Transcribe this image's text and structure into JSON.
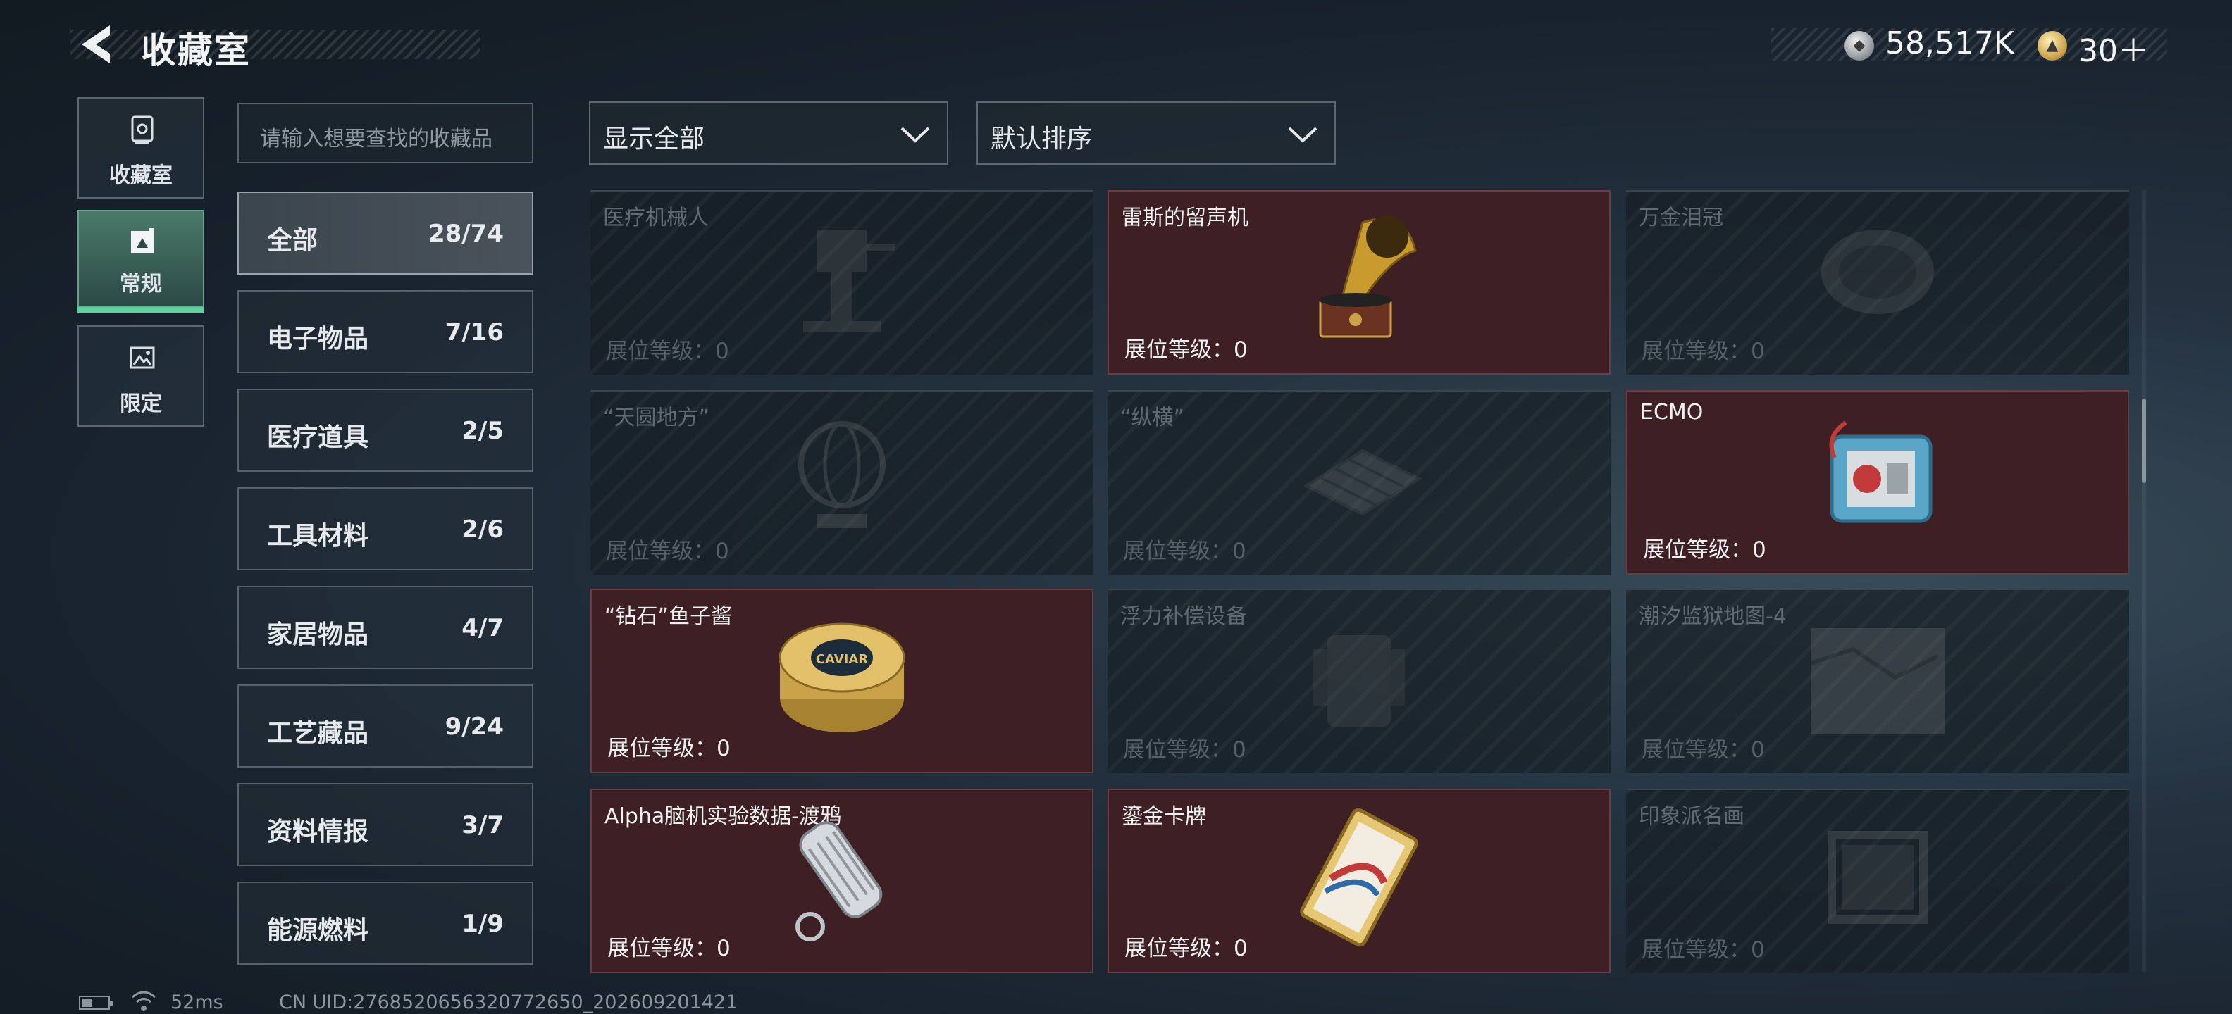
{
  "header": {
    "title": "收藏室"
  },
  "currency": {
    "silver_amount": "58,517K",
    "gold_amount": "30＋"
  },
  "nav_tabs": [
    {
      "label": "收藏室",
      "icon": "vault-icon",
      "active": false
    },
    {
      "label": "常规",
      "icon": "frame-icon",
      "active": true
    },
    {
      "label": "限定",
      "icon": "picture-icon",
      "active": false
    }
  ],
  "search": {
    "placeholder": "请输入想要查找的收藏品"
  },
  "filters": {
    "show_label": "显示全部",
    "sort_label": "默认排序"
  },
  "categories": [
    {
      "name": "全部",
      "count": "28/74",
      "active": true
    },
    {
      "name": "电子物品",
      "count": "7/16"
    },
    {
      "name": "医疗道具",
      "count": "2/5"
    },
    {
      "name": "工具材料",
      "count": "2/6"
    },
    {
      "name": "家居物品",
      "count": "4/7"
    },
    {
      "name": "工艺藏品",
      "count": "9/24"
    },
    {
      "name": "资料情报",
      "count": "3/7"
    },
    {
      "name": "能源燃料",
      "count": "1/9"
    }
  ],
  "items": [
    {
      "name": "医疗机械人",
      "level": "展位等级：0",
      "owned": false,
      "icon": "robot-icon"
    },
    {
      "name": "雷斯的留声机",
      "level": "展位等级：0",
      "owned": true,
      "icon": "gramophone-icon"
    },
    {
      "name": "万金泪冠",
      "level": "展位等级：0",
      "owned": false,
      "icon": "crown-icon"
    },
    {
      "name": "“天圆地方”",
      "level": "展位等级：0",
      "owned": false,
      "icon": "globe-icon"
    },
    {
      "name": "“纵横”",
      "level": "展位等级：0",
      "owned": false,
      "icon": "chessboard-icon"
    },
    {
      "name": "ECMO",
      "level": "展位等级：0",
      "owned": true,
      "icon": "ecmo-machine-icon"
    },
    {
      "name": "“钻石”鱼子酱",
      "level": "展位等级：0",
      "owned": true,
      "icon": "caviar-tin-icon",
      "tin_text": "CAVIAR"
    },
    {
      "name": "浮力补偿设备",
      "level": "展位等级：0",
      "owned": false,
      "icon": "bcd-icon"
    },
    {
      "name": "潮汐监狱地图-4",
      "level": "展位等级：0",
      "owned": false,
      "icon": "map-icon"
    },
    {
      "name": "Alpha脑机实验数据-渡鸦",
      "level": "展位等级：0",
      "owned": true,
      "icon": "data-drive-icon"
    },
    {
      "name": "鎏金卡牌",
      "level": "展位等级：0",
      "owned": true,
      "icon": "gilded-card-icon"
    },
    {
      "name": "印象派名画",
      "level": "展位等级：0",
      "owned": false,
      "icon": "painting-icon"
    }
  ],
  "status_bar": {
    "ping": "52ms",
    "uid": "CN UID:2768520656320772650_202609201421"
  },
  "colors": {
    "owned_card": "#3e2024",
    "active_tab": "#5cd29c",
    "locked_card": "#161e26"
  }
}
